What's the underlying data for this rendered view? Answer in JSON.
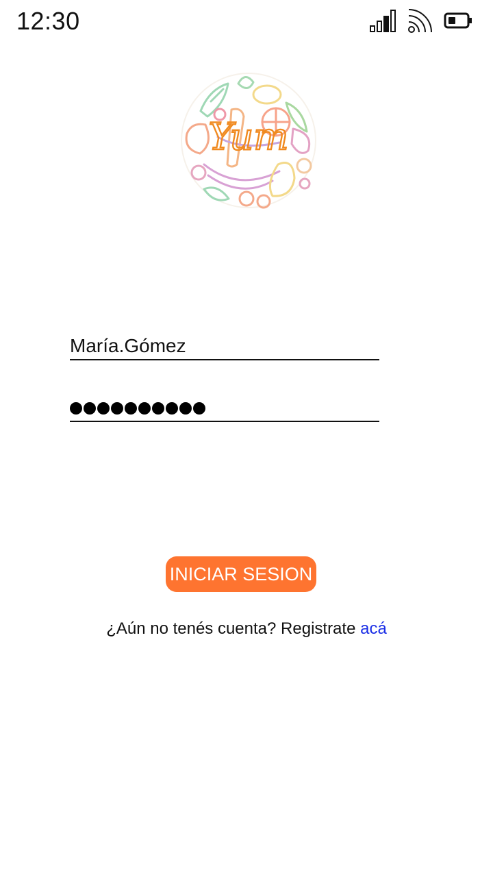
{
  "status_bar": {
    "time": "12:30",
    "icons": [
      "cellular-signal-icon",
      "wifi-icon",
      "battery-icon"
    ]
  },
  "logo": {
    "text": "Yum",
    "accent_color": "#f08a20"
  },
  "login_form": {
    "username_value": "María.Gómez",
    "password_masked": "●●●●●●●●●●",
    "password_length": 10,
    "submit_label": "INICIAR SESION",
    "submit_color": "#fe7430"
  },
  "register": {
    "prompt": "¿Aún no tenés cuenta? Registrate",
    "link_label": "acá",
    "link_color": "#1a2ee6"
  }
}
